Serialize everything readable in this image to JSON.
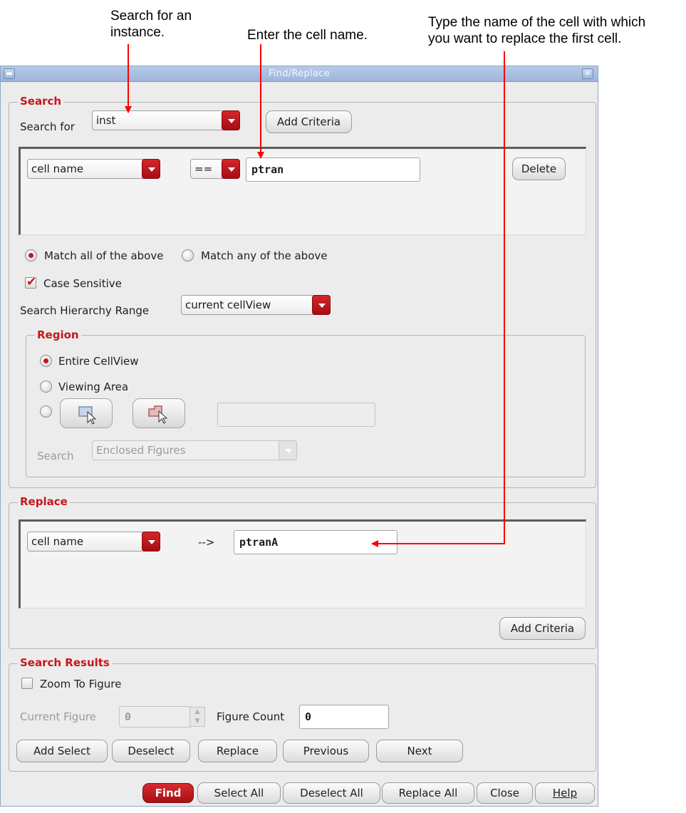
{
  "annotations": {
    "search_instance": [
      "Search for an",
      "instance."
    ],
    "enter_cell": "Enter the cell name.",
    "type_name": [
      "Type the name of the cell with which",
      "you want to replace the first cell."
    ]
  },
  "window": {
    "title": "Find/Replace"
  },
  "search": {
    "group_label": "Search",
    "search_for_label": "Search for",
    "search_for_value": "inst",
    "add_criteria_label": "Add Criteria",
    "criteria": {
      "field_value": "cell name",
      "operator_value": "==",
      "text_value": "ptran",
      "delete_label": "Delete"
    },
    "match_all_label": "Match all of the above",
    "match_any_label": "Match any of the above",
    "case_sensitive_label": "Case Sensitive",
    "hierarchy_label": "Search Hierarchy Range",
    "hierarchy_value": "current cellView"
  },
  "region": {
    "group_label": "Region",
    "entire_label": "Entire CellView",
    "viewing_label": "Viewing Area",
    "search_label": "Search",
    "search_value": "Enclosed Figures"
  },
  "replace": {
    "group_label": "Replace",
    "field_value": "cell name",
    "arrow_text": "-->",
    "text_value": "ptranA",
    "add_criteria_label": "Add Criteria"
  },
  "results": {
    "group_label": "Search Results",
    "zoom_label": "Zoom To Figure",
    "current_figure_label": "Current Figure",
    "current_figure_value": "0",
    "figure_count_label": "Figure Count",
    "figure_count_value": "0",
    "buttons": {
      "add_select": "Add Select",
      "deselect": "Deselect",
      "replace": "Replace",
      "previous": "Previous",
      "next": "Next"
    }
  },
  "footer": {
    "find": "Find",
    "select_all": "Select All",
    "deselect_all": "Deselect All",
    "replace_all": "Replace All",
    "close": "Close",
    "help": "Help"
  },
  "colors": {
    "accent_red": "#c8151b",
    "title_bar": "#a8bfe0",
    "annotation_arrow": "#ff0000"
  }
}
